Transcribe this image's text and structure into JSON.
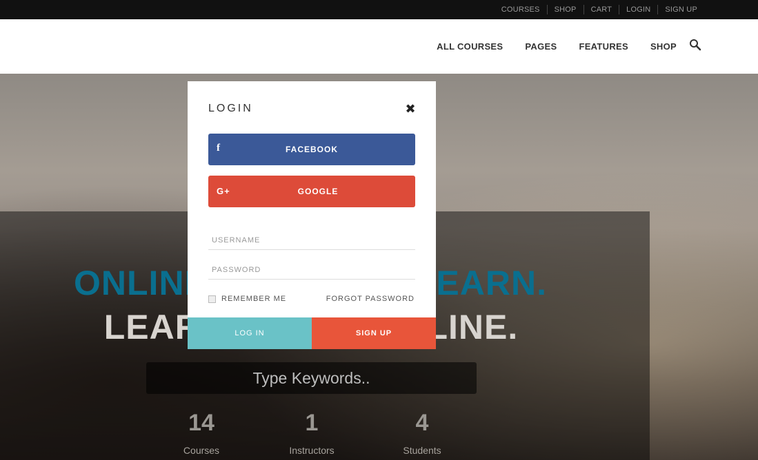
{
  "topbar": {
    "links": [
      "COURSES",
      "SHOP",
      "CART",
      "LOGIN",
      "SIGN UP"
    ]
  },
  "nav": {
    "items": [
      "ALL COURSES",
      "PAGES",
      "FEATURES",
      "SHOP"
    ],
    "search_icon": "search-icon"
  },
  "hero": {
    "headline_line1": "ONLINE COURSES. LEARN.",
    "headline_line2": "LEARN SKILLS ONLINE.",
    "search_placeholder": "Type Keywords..",
    "stats": [
      {
        "value": "14",
        "label": "Courses"
      },
      {
        "value": "1",
        "label": "Instructors"
      },
      {
        "value": "4",
        "label": "Students"
      }
    ]
  },
  "modal": {
    "title": "LOGIN",
    "close_icon": "close-icon",
    "facebook_label": "FACEBOOK",
    "facebook_icon": "facebook-icon",
    "google_label": "GOOGLE",
    "google_icon": "google-plus-icon",
    "username_placeholder": "USERNAME",
    "password_placeholder": "PASSWORD",
    "remember_label": "REMEMBER ME",
    "forgot_label": "FORGOT PASSWORD",
    "login_label": "LOG IN",
    "signup_label": "SIGN UP"
  },
  "colors": {
    "facebook": "#3b5998",
    "google": "#dd4b39",
    "login_button": "#6ac2c7",
    "signup_button": "#e8553a",
    "headline_accent": "#0a6f8f"
  }
}
